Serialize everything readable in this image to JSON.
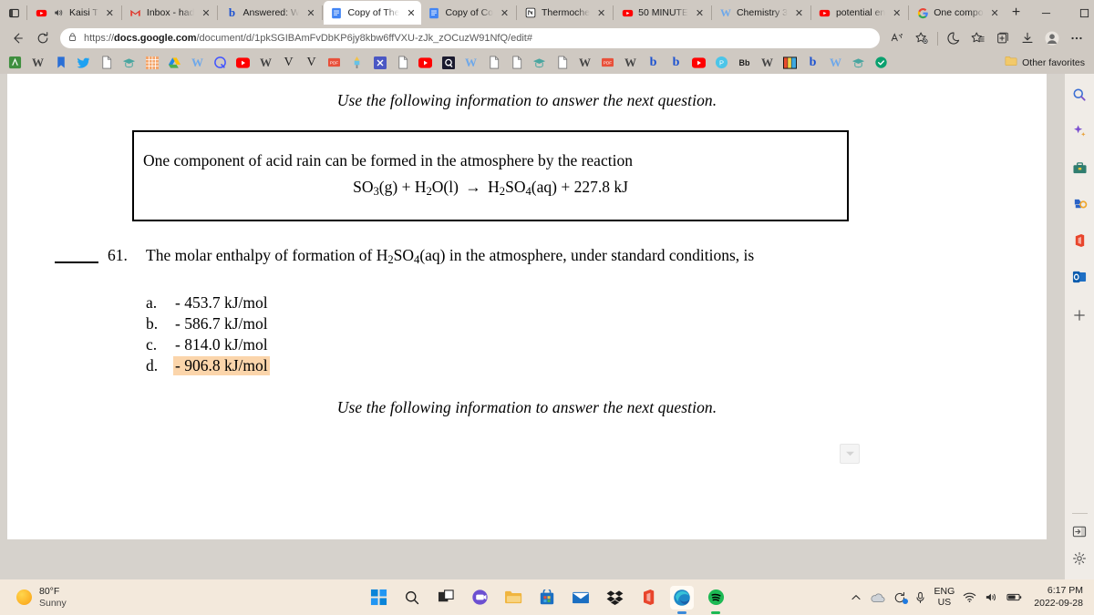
{
  "browser": {
    "tabs": [
      {
        "title": "Kaisi T",
        "favicon": "youtube-icon",
        "active": false,
        "muted": true
      },
      {
        "title": "Inbox - had",
        "favicon": "gmail-icon",
        "active": false
      },
      {
        "title": "Answered: W",
        "favicon": "brainly-icon",
        "active": false
      },
      {
        "title": "Copy of The",
        "favicon": "google-docs-icon",
        "active": true
      },
      {
        "title": "Copy of Co",
        "favicon": "google-docs-icon",
        "active": false
      },
      {
        "title": "Thermoche",
        "favicon": "notion-icon",
        "active": false
      },
      {
        "title": "50 MINUTE",
        "favicon": "youtube-icon",
        "active": false
      },
      {
        "title": "Chemistry 3",
        "favicon": "wattpad-icon",
        "active": false
      },
      {
        "title": "potential en",
        "favicon": "youtube-icon",
        "active": false
      },
      {
        "title": "One compo",
        "favicon": "google-icon",
        "active": false
      }
    ],
    "new_tab_label": "+",
    "window_controls": [
      "minimize",
      "maximize",
      "close"
    ],
    "nav": {
      "back": "back-arrow",
      "refresh": "refresh-arrow",
      "url_prefix": "https://",
      "url_domain": "docs.google.com",
      "url_path": "/document/d/1pkSGIBAmFvDbKP6jy8kbw6ffVXU-zJk_zOCuzW91NfQ/edit#",
      "right_icons": [
        "read-aloud-icon",
        "add-favorite-icon",
        "browser-essentials-icon",
        "favorites-icon",
        "collections-icon",
        "downloads-icon",
        "profile-icon",
        "settings-more-icon"
      ]
    },
    "bookmarks": {
      "items": [
        "achieve-icon",
        "wattpad-icon",
        "bookmark-icon",
        "twitter-icon",
        "doc-icon",
        "school-icon",
        "grid-icon",
        "google-drive-icon",
        "wattpad-icon",
        "quizlet-icon",
        "youtube-icon",
        "wattpad-icon",
        "v-icon",
        "v-icon",
        "pdf-icon",
        "paint-icon",
        "excel-icon",
        "doc-icon",
        "youtube-icon",
        "quizlet-dark-icon",
        "wattpad-icon",
        "doc-icon",
        "doc-icon",
        "school-green-icon",
        "doc-icon",
        "wattpad-icon",
        "pdf-icon",
        "wattpad-icon",
        "brainly-icon",
        "brainly-icon",
        "youtube-icon",
        "prezi-icon",
        "blackboard-icon",
        "wattpad-icon",
        "ib-icon",
        "brainly-icon",
        "wattpad-icon",
        "school-green-icon",
        "shield-check-icon"
      ],
      "other_favorites_label": "Other favorites",
      "other_favorites_icon": "folder-icon"
    },
    "sidebar": {
      "top_icons": [
        "search-icon",
        "copilot-icon",
        "tools-icon",
        "games-icon",
        "office-icon",
        "outlook-icon",
        "add-sidebar-icon"
      ],
      "bottom_icons": [
        "collapse-panel-icon",
        "settings-gear-icon"
      ]
    }
  },
  "document": {
    "lead_line_1": "Use the following information to answer the next question.",
    "lead_line_2": "Use the following information to answer the next question.",
    "info_box": {
      "text": "One component of acid rain can be formed in the atmosphere by the reaction",
      "equation": {
        "reactant_1": "SO",
        "reactant_1_sub": "3",
        "reactant_1_state": "(g)",
        "plus_1": "+",
        "reactant_2_a": "H",
        "reactant_2_sub": "2",
        "reactant_2_b": "O(l)",
        "arrow": "→",
        "product_a": "H",
        "product_sub_1": "2",
        "product_b": "SO",
        "product_sub_2": "4",
        "product_state": "(aq)",
        "plus_2": "+",
        "energy": "227.8 kJ"
      }
    },
    "question": {
      "number": "61.",
      "text_part_1": "The molar enthalpy of formation of H",
      "sub_1": "2",
      "text_part_2": "SO",
      "sub_2": "4",
      "text_part_3": "(aq) in the atmosphere, under standard conditions, is",
      "options": [
        {
          "mark": "a.",
          "value": "- 453.7 kJ/mol",
          "highlighted": false
        },
        {
          "mark": "b.",
          "value": "- 586.7 kJ/mol",
          "highlighted": false
        },
        {
          "mark": "c.",
          "value": "- 814.0 kJ/mol",
          "highlighted": false
        },
        {
          "mark": "d.",
          "value": "- 906.8 kJ/mol",
          "highlighted": true
        }
      ]
    },
    "collapse_control": "chevron-down-icon",
    "highlight_color": "#fbd5ab"
  },
  "taskbar": {
    "weather": {
      "temperature": "80°F",
      "condition": "Sunny",
      "icon": "sun-icon"
    },
    "apps": [
      {
        "name": "start-button",
        "icon": "windows-icon"
      },
      {
        "name": "search",
        "icon": "search-icon"
      },
      {
        "name": "task-view",
        "icon": "task-view-icon"
      },
      {
        "name": "teams",
        "icon": "teams-icon"
      },
      {
        "name": "file-explorer",
        "icon": "folder-icon"
      },
      {
        "name": "microsoft-store",
        "icon": "store-icon"
      },
      {
        "name": "mail",
        "icon": "mail-icon"
      },
      {
        "name": "dropbox",
        "icon": "dropbox-icon"
      },
      {
        "name": "office",
        "icon": "office-icon"
      },
      {
        "name": "edge",
        "icon": "edge-icon"
      },
      {
        "name": "spotify",
        "icon": "spotify-icon"
      }
    ],
    "tray": {
      "overflow": "chevron-up-icon",
      "onedrive": "onedrive-icon",
      "update": "windows-update-icon",
      "mic": "microphone-icon",
      "language_line_1": "ENG",
      "language_line_2": "US",
      "wifi": "wifi-icon",
      "volume": "speaker-icon",
      "battery": "battery-icon",
      "time": "6:17 PM",
      "date": "2022-09-28"
    }
  }
}
